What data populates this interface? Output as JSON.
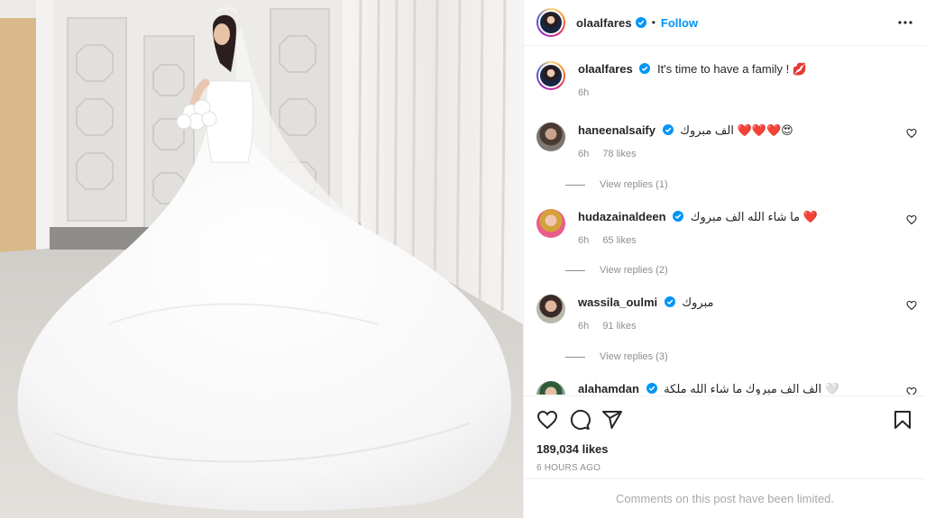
{
  "post": {
    "author": "olaalfares",
    "follow_label": "Follow",
    "separator": "•",
    "caption": "It's time to have a family ! 💋",
    "caption_time": "6h",
    "likes": "189,034 likes",
    "time_ago": "6 HOURS AGO",
    "comments_limited": "Comments on this post have been limited."
  },
  "comments": [
    {
      "user": "haneenalsaify",
      "text": "الف مبروك ❤️❤️❤️😍",
      "time": "6h",
      "likes": "78 likes",
      "replies": "View replies (1)"
    },
    {
      "user": "hudazainaldeen",
      "text": "ما شاء الله الف مبروك ❤️",
      "time": "6h",
      "likes": "65 likes",
      "replies": "View replies (2)"
    },
    {
      "user": "wassila_oulmi",
      "text": "مبروك",
      "time": "6h",
      "likes": "91 likes",
      "replies": "View replies (3)"
    },
    {
      "user": "alahamdan",
      "text": "الف الف مبروك ما شاء الله ملكة 🤍"
    }
  ],
  "icons": {
    "verified": "verified-badge-icon",
    "more": "more-options-icon",
    "like": "heart-icon",
    "comment": "comment-icon",
    "share": "share-icon",
    "save": "bookmark-icon"
  },
  "colors": {
    "accent": "#0095f6",
    "verified": "#0095f6",
    "muted": "#8e8e8e"
  }
}
